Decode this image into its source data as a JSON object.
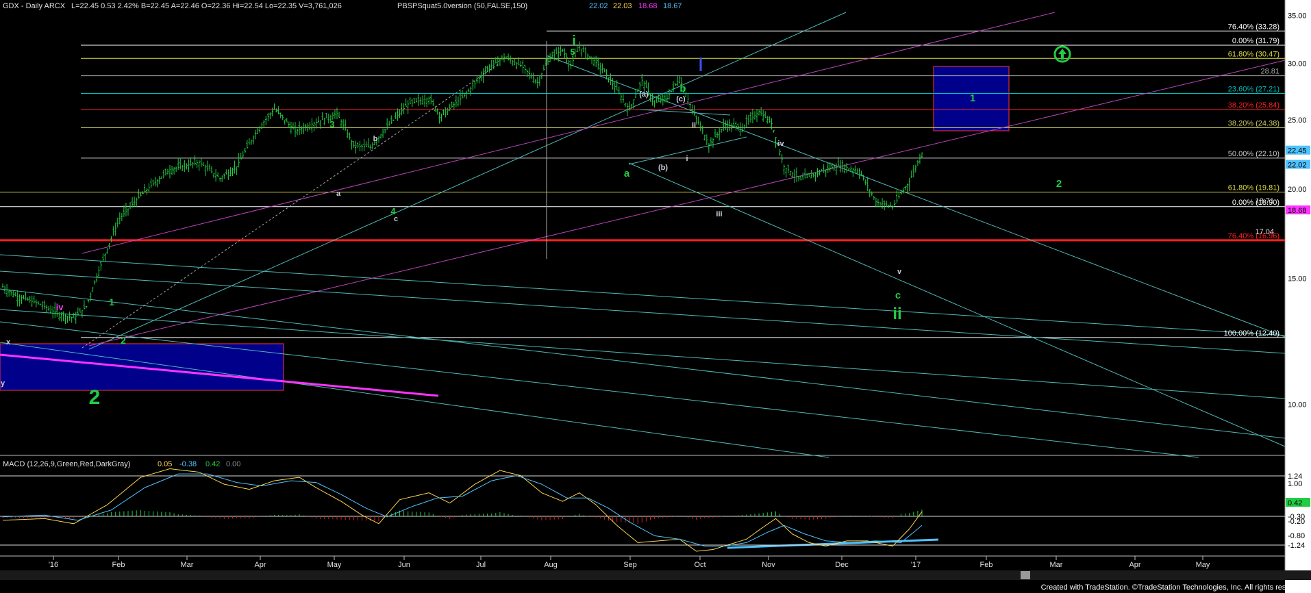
{
  "header": {
    "symbol": "GDX - Daily  ARCX",
    "quote": "L=22.45  0.53  2.42%  B=22.45  A=22.46  O=22.36  Hi=22.54  Lo=22.35  V=3,761,026",
    "indicator": "PBSPSquat5.0version (50,FALSE,150)",
    "ind_values": [
      {
        "text": "22.02",
        "color": "#4fc3ff"
      },
      {
        "text": "22.03",
        "color": "#ffd54f"
      },
      {
        "text": "18.68",
        "color": "#ff33ff"
      },
      {
        "text": "18.67",
        "color": "#4fc3ff"
      }
    ]
  },
  "macd_header": {
    "label": "MACD (12,26,9,Green,Red,DarkGray)",
    "values": [
      {
        "text": "0.05",
        "color": "#ffd54f"
      },
      {
        "text": "-0.38",
        "color": "#4fc3ff"
      },
      {
        "text": "0.42",
        "color": "#22cc44"
      },
      {
        "text": "0.00",
        "color": "#888888"
      }
    ]
  },
  "credit": "Created with TradeStation. ©TradeStation Technologies, Inc. All rights reserved.",
  "chart_data": {
    "type": "candlestick",
    "price_axis": {
      "scale": "log",
      "range": [
        8.5,
        35.5
      ],
      "ticks": [
        "35.00",
        "30.00",
        "25.00",
        "20.00",
        "15.00",
        "10.00"
      ]
    },
    "x_labels": [
      "'16",
      "Feb",
      "Mar",
      "Apr",
      "May",
      "Jun",
      "Jul",
      "Aug",
      "Sep",
      "Oct",
      "Nov",
      "Dec",
      "'17",
      "Feb",
      "Mar",
      "Apr",
      "May"
    ],
    "price_path": [
      [
        0,
        14.6
      ],
      [
        6,
        14.2
      ],
      [
        18,
        13.8
      ],
      [
        26,
        13.4
      ],
      [
        34,
        13.2
      ],
      [
        40,
        13.7
      ],
      [
        50,
        16.5
      ],
      [
        56,
        18.2
      ],
      [
        66,
        19.6
      ],
      [
        80,
        21.3
      ],
      [
        94,
        21.8
      ],
      [
        104,
        20.7
      ],
      [
        112,
        21.5
      ],
      [
        122,
        24.2
      ],
      [
        130,
        25.9
      ],
      [
        140,
        24.1
      ],
      [
        150,
        24.8
      ],
      [
        160,
        25.5
      ],
      [
        168,
        23.0
      ],
      [
        176,
        22.9
      ],
      [
        185,
        24.6
      ],
      [
        194,
        26.3
      ],
      [
        204,
        26.8
      ],
      [
        210,
        25.3
      ],
      [
        222,
        27.2
      ],
      [
        232,
        29.5
      ],
      [
        240,
        30.6
      ],
      [
        248,
        29.8
      ],
      [
        256,
        28.2
      ],
      [
        262,
        30.6
      ],
      [
        268,
        31.3
      ],
      [
        272,
        29.8
      ],
      [
        276,
        31.6
      ],
      [
        280,
        30.8
      ],
      [
        286,
        29.7
      ],
      [
        292,
        28.1
      ],
      [
        300,
        25.8
      ],
      [
        306,
        28.4
      ],
      [
        312,
        26.4
      ],
      [
        318,
        26.8
      ],
      [
        324,
        28.6
      ],
      [
        330,
        25.8
      ],
      [
        338,
        23.1
      ],
      [
        346,
        24.6
      ],
      [
        354,
        24.4
      ],
      [
        362,
        25.7
      ],
      [
        368,
        24.7
      ],
      [
        374,
        21.5
      ],
      [
        382,
        20.6
      ],
      [
        392,
        21.2
      ],
      [
        400,
        21.6
      ],
      [
        410,
        21.2
      ],
      [
        418,
        19.2
      ],
      [
        426,
        18.9
      ],
      [
        434,
        20.5
      ],
      [
        440,
        22.45
      ]
    ],
    "price_labels": [
      {
        "text": "22.45",
        "bg": "#4fc3ff",
        "value": 22.45
      },
      {
        "text": "22.02",
        "bg": "#4fc3ff",
        "value": 22.02
      },
      {
        "text": "18.68",
        "bg": "#ff33ff",
        "value": 18.68
      }
    ],
    "horizontal_lines": [
      {
        "value": 33.28,
        "color": "#ffffff",
        "label": "76.40% (33.28)"
      },
      {
        "value": 31.79,
        "color": "#ffffff",
        "label": "0.00% (31.79)"
      },
      {
        "value": 30.47,
        "color": "#dddd44",
        "label": "61.80% (30.47)"
      },
      {
        "value": 28.81,
        "color": "#aaaaaa",
        "label": "28.81"
      },
      {
        "value": 27.21,
        "color": "#00bbbb",
        "label": "23.60% (27.21)"
      },
      {
        "value": 25.84,
        "color": "#ff2222",
        "label": "38.20% (25.84)"
      },
      {
        "value": 24.38,
        "color": "#cccc66",
        "label": "38.20% (24.38)"
      },
      {
        "value": 22.1,
        "color": "#cccccc",
        "label": "50.00% (22.10)"
      },
      {
        "value": 19.81,
        "color": "#dddd44",
        "label": "61.80% (19.81)"
      },
      {
        "value": 18.9,
        "color": "#ffffff",
        "label": "0.00% (18.90)"
      },
      {
        "value": 16.96,
        "color": "#ff2222",
        "label": "76.40% (16.96)"
      },
      {
        "value": 12.4,
        "color": "#ffffff",
        "label": "100.00% (12.40)"
      }
    ],
    "extra_price_texts": [
      {
        "text": "18.71",
        "value": 19.1
      },
      {
        "text": "17.04",
        "value": 17.3
      }
    ],
    "wave_labels": [
      {
        "text": "i",
        "color": "#22cc44",
        "size": 20
      },
      {
        "text": "5",
        "color": "#22cc44",
        "size": 12
      },
      {
        "text": "3",
        "color": "#22cc44",
        "size": 13
      },
      {
        "text": "4",
        "color": "#22cc44",
        "size": 13
      },
      {
        "text": "b",
        "color": "#22cc44",
        "size": 15
      },
      {
        "text": "a",
        "color": "#22cc44",
        "size": 15
      },
      {
        "text": "c",
        "color": "#22cc44",
        "size": 15
      },
      {
        "text": "ii",
        "color": "#22cc44",
        "size": 24
      },
      {
        "text": "1",
        "color": "#22cc44",
        "size": 15
      },
      {
        "text": "2",
        "color": "#22cc44",
        "size": 15
      },
      {
        "text": "1",
        "color": "#22cc44",
        "size": 14
      },
      {
        "text": "2",
        "color": "#22cc44",
        "size": 14
      },
      {
        "text": "2",
        "color": "#22cc44",
        "size": 30
      },
      {
        "text": "iv",
        "color": "#ee44ee",
        "size": 13
      },
      {
        "text": "(a)",
        "color": "#ccccdd",
        "size": 11
      },
      {
        "text": "(b)",
        "color": "#ccccdd",
        "size": 11
      },
      {
        "text": "(c)",
        "color": "#ccccdd",
        "size": 11
      },
      {
        "text": "b",
        "color": "#ccccdd",
        "size": 11
      },
      {
        "text": "a",
        "color": "#ccccdd",
        "size": 11
      },
      {
        "text": "c",
        "color": "#ccccdd",
        "size": 11
      },
      {
        "text": "ii",
        "color": "#ccccdd",
        "size": 11
      },
      {
        "text": "i",
        "color": "#ccccdd",
        "size": 11
      },
      {
        "text": "iii",
        "color": "#ccccdd",
        "size": 11
      },
      {
        "text": "iv",
        "color": "#ccccdd",
        "size": 11
      },
      {
        "text": "v",
        "color": "#ccccdd",
        "size": 11
      },
      {
        "text": "x",
        "color": "#ccccdd",
        "size": 11
      },
      {
        "text": "y",
        "color": "#ccccdd",
        "size": 11
      }
    ],
    "macd": {
      "axis_ticks": [
        "1.24",
        "1.00",
        "-0.30",
        "-0.20",
        "-0.80",
        "-1.24"
      ],
      "last_value_label": "0.42",
      "macd_path": [
        [
          0,
          -0.35
        ],
        [
          20,
          -0.3
        ],
        [
          34,
          -0.45
        ],
        [
          50,
          0.1
        ],
        [
          66,
          0.9
        ],
        [
          80,
          1.15
        ],
        [
          94,
          1.05
        ],
        [
          106,
          0.7
        ],
        [
          118,
          0.55
        ],
        [
          130,
          0.8
        ],
        [
          142,
          0.9
        ],
        [
          150,
          0.6
        ],
        [
          162,
          0.2
        ],
        [
          172,
          -0.2
        ],
        [
          180,
          -0.45
        ],
        [
          190,
          0.25
        ],
        [
          204,
          0.45
        ],
        [
          214,
          0.15
        ],
        [
          226,
          0.7
        ],
        [
          238,
          1.1
        ],
        [
          248,
          0.95
        ],
        [
          258,
          0.45
        ],
        [
          268,
          0.2
        ],
        [
          276,
          0.45
        ],
        [
          284,
          0.1
        ],
        [
          294,
          -0.5
        ],
        [
          304,
          -1.0
        ],
        [
          314,
          -0.95
        ],
        [
          324,
          -0.9
        ],
        [
          332,
          -1.25
        ],
        [
          340,
          -1.2
        ],
        [
          348,
          -1.05
        ],
        [
          356,
          -0.9
        ],
        [
          364,
          -0.55
        ],
        [
          370,
          -0.3
        ],
        [
          378,
          -0.75
        ],
        [
          386,
          -1.0
        ],
        [
          394,
          -1.1
        ],
        [
          404,
          -0.95
        ],
        [
          414,
          -0.95
        ],
        [
          426,
          -1.1
        ],
        [
          434,
          -0.6
        ],
        [
          440,
          -0.1
        ]
      ],
      "signal_path": [
        [
          0,
          -0.25
        ],
        [
          20,
          -0.2
        ],
        [
          36,
          -0.35
        ],
        [
          52,
          -0.05
        ],
        [
          68,
          0.6
        ],
        [
          84,
          1.0
        ],
        [
          98,
          1.0
        ],
        [
          112,
          0.75
        ],
        [
          124,
          0.65
        ],
        [
          138,
          0.8
        ],
        [
          150,
          0.75
        ],
        [
          162,
          0.4
        ],
        [
          174,
          0.0
        ],
        [
          184,
          -0.25
        ],
        [
          196,
          0.05
        ],
        [
          208,
          0.3
        ],
        [
          220,
          0.35
        ],
        [
          234,
          0.8
        ],
        [
          246,
          0.95
        ],
        [
          258,
          0.7
        ],
        [
          270,
          0.3
        ],
        [
          280,
          0.3
        ],
        [
          290,
          0.0
        ],
        [
          300,
          -0.4
        ],
        [
          312,
          -0.8
        ],
        [
          324,
          -0.9
        ],
        [
          336,
          -1.1
        ],
        [
          346,
          -1.1
        ],
        [
          356,
          -1.0
        ],
        [
          366,
          -0.7
        ],
        [
          374,
          -0.5
        ],
        [
          384,
          -0.75
        ],
        [
          394,
          -0.95
        ],
        [
          406,
          -1.0
        ],
        [
          418,
          -0.95
        ],
        [
          430,
          -1.0
        ],
        [
          440,
          -0.5
        ]
      ],
      "hist_range": [
        -0.3,
        0.42
      ]
    }
  }
}
